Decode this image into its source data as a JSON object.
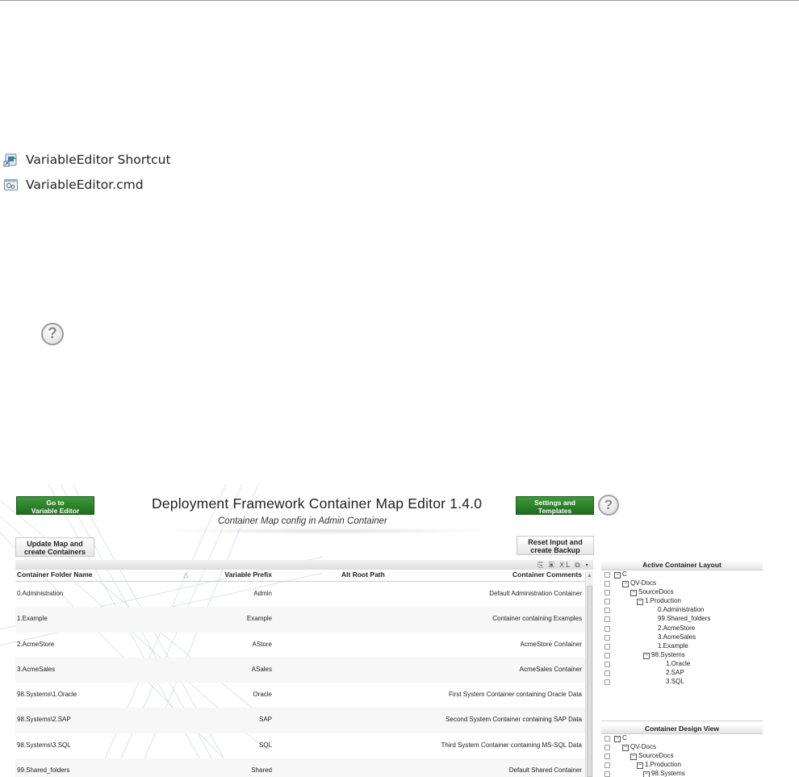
{
  "files": [
    {
      "icon": "shortcut-icon",
      "label": "VariableEditor Shortcut"
    },
    {
      "icon": "cmd-file-icon",
      "label": "VariableEditor.cmd"
    }
  ],
  "help_glyph": "?",
  "app": {
    "title": "Deployment Framework Container Map Editor 1.4.0",
    "subtitle": "Container Map config in Admin Container",
    "buttons": {
      "goto_variable_editor": "Go to\nVariable Editor",
      "settings_templates": "Settings and\nTemplates",
      "update_map": "Update Map and\ncreate Containers",
      "reset_input": "Reset Input and\ncreate Backup"
    },
    "table": {
      "tools": "⎘ ▣ XL ⧉ ▾",
      "sort_indicator": "△",
      "columns": [
        "Container Folder Name",
        "Variable Prefix",
        "Alt Root Path",
        "Container Comments"
      ],
      "rows": [
        {
          "folder": "0.Administration",
          "prefix": "Admin",
          "alt": "",
          "comment": "Default Administration Container"
        },
        {
          "folder": "1.Example",
          "prefix": "Example",
          "alt": "",
          "comment": "Container containing Examples"
        },
        {
          "folder": "2.AcmeStore",
          "prefix": "AStore",
          "alt": "",
          "comment": "AcmeStore Container"
        },
        {
          "folder": "3.AcmeSales",
          "prefix": "ASales",
          "alt": "",
          "comment": "AcmeSales Container"
        },
        {
          "folder": "98.Systems\\1.Oracle",
          "prefix": "Oracle",
          "alt": "",
          "comment": "First System Container containing Oracle Data"
        },
        {
          "folder": "98.Systems\\2.SAP",
          "prefix": "SAP",
          "alt": "",
          "comment": "Second System Container containing SAP Data"
        },
        {
          "folder": "98.Systems\\3.SQL",
          "prefix": "SQL",
          "alt": "",
          "comment": "Third System Container containing MS-SQL Data"
        },
        {
          "folder": "99.Shared_folders",
          "prefix": "Shared",
          "alt": "",
          "comment": "Default Shared Container"
        }
      ]
    },
    "active_layout": {
      "title": "Active Container Layout",
      "nodes": [
        {
          "label": "C",
          "twisty": "−"
        },
        {
          "label": "QV-Docs",
          "twisty": "−"
        },
        {
          "label": "SourceDocs",
          "twisty": "−"
        },
        {
          "label": "1.Production",
          "twisty": "−"
        },
        {
          "label": "0.Administration",
          "twisty": ""
        },
        {
          "label": "99.Shared_folders",
          "twisty": ""
        },
        {
          "label": "2.AcmeStore",
          "twisty": ""
        },
        {
          "label": "3.AcmeSales",
          "twisty": ""
        },
        {
          "label": "1.Example",
          "twisty": ""
        },
        {
          "label": "98.Systems",
          "twisty": "−"
        },
        {
          "label": "1.Oracle",
          "twisty": ""
        },
        {
          "label": "2.SAP",
          "twisty": ""
        },
        {
          "label": "3.SQL",
          "twisty": ""
        }
      ]
    },
    "design_view": {
      "title": "Container Design View",
      "nodes": [
        {
          "label": "C",
          "twisty": "−"
        },
        {
          "label": "QV-Docs",
          "twisty": "−"
        },
        {
          "label": "SourceDocs",
          "twisty": "−"
        },
        {
          "label": "1.Production",
          "twisty": "−"
        },
        {
          "label": "98.Systems",
          "twisty": "−"
        }
      ]
    }
  }
}
